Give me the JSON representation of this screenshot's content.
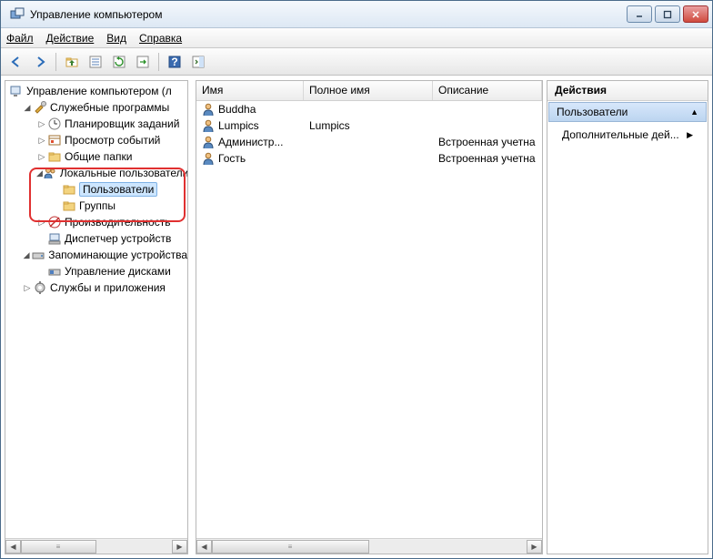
{
  "window": {
    "title": "Управление компьютером"
  },
  "menubar": {
    "file": "Файл",
    "action": "Действие",
    "view": "Вид",
    "help": "Справка"
  },
  "tree": {
    "root": "Управление компьютером (л",
    "system_tools": "Служебные программы",
    "task_scheduler": "Планировщик заданий",
    "event_viewer": "Просмотр событий",
    "shared_folders": "Общие папки",
    "local_users": "Локальные пользователи",
    "users": "Пользователи",
    "groups": "Группы",
    "performance": "Производительность",
    "device_manager": "Диспетчер устройств",
    "storage": "Запоминающие устройства",
    "disk_management": "Управление дисками",
    "services_apps": "Службы и приложения"
  },
  "columns": {
    "name": "Имя",
    "full_name": "Полное имя",
    "description": "Описание"
  },
  "col_widths": {
    "name": 118,
    "full_name": 142,
    "description": 120
  },
  "users": [
    {
      "name": "Buddha",
      "full_name": "",
      "description": ""
    },
    {
      "name": "Lumpics",
      "full_name": "Lumpics",
      "description": ""
    },
    {
      "name": "Администр...",
      "full_name": "",
      "description": "Встроенная учетна"
    },
    {
      "name": "Гость",
      "full_name": "",
      "description": "Встроенная учетна"
    }
  ],
  "actions": {
    "header": "Действия",
    "subheader": "Пользователи",
    "more": "Дополнительные дей..."
  }
}
